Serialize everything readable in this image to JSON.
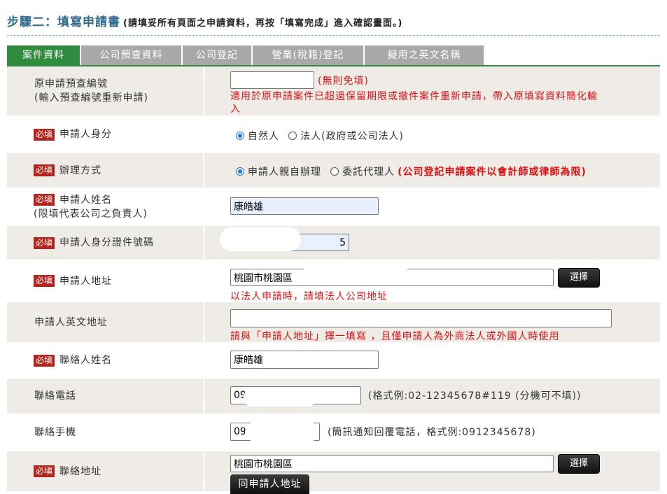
{
  "header": {
    "title": "步驟二：填寫申請書",
    "note": "(請填妥所有頁面之申請資料，再按「填寫完成」進入確認畫面。)"
  },
  "tabs": [
    {
      "label": "案件資料",
      "active": true
    },
    {
      "label": "公司預查資料",
      "active": false
    },
    {
      "label": "公司登記",
      "active": false
    },
    {
      "label": "營業(稅籍)登記",
      "active": false
    },
    {
      "label": "擬用之英文名稱",
      "active": false
    }
  ],
  "required_badge": "必塡",
  "form": {
    "prev_case": {
      "label_line1": "原申請預查編號",
      "label_line2": "(輸入預查編號重新申請)",
      "value": "",
      "optional_note": "(無則免填)",
      "help_line1": "適用於原申請案件已超過保留期限或撤件案件重新申請，帶入原填寫資料簡化輸",
      "help_line2": "入"
    },
    "applicant_identity": {
      "label": "申請人身分",
      "options": [
        "自然人",
        "法人(政府或公司法人)"
      ],
      "selected": "自然人"
    },
    "handling_method": {
      "label": "辦理方式",
      "options": [
        "申請人親自辦理",
        "委託代理人"
      ],
      "selected": "申請人親自辦理",
      "note": "(公司登記申請案件以會計師或律師為限)"
    },
    "applicant_name": {
      "label_line1": "申請人姓名",
      "label_line2": "(限填代表公司之負責人)",
      "value": "康皓雄"
    },
    "applicant_id": {
      "label": "申請人身分證件號碼",
      "value": "5"
    },
    "applicant_address": {
      "label": "申請人地址",
      "value": "桃園市桃園區",
      "button": "選擇",
      "help": "以法人申請時，請填法人公司地址"
    },
    "applicant_en_address": {
      "label": "申請人英文地址",
      "value": "",
      "help": "請與「申請人地址」擇一填寫 ，且僅申請人為外商法人或外國人時使用"
    },
    "contact_name": {
      "label": "聯絡人姓名",
      "value": "康皓雄"
    },
    "contact_phone": {
      "label": "聯絡電話",
      "value": "09",
      "hint": "(格式例:02-12345678#119 (分機可不填))"
    },
    "contact_mobile": {
      "label": "聯絡手機",
      "value": "09",
      "hint": "(簡訊通知回覆電話，格式例:0912345678)"
    },
    "contact_address": {
      "label": "聯絡地址",
      "value": "桃園市桃園區",
      "button": "選擇",
      "same_button": "同申請人地址"
    }
  }
}
